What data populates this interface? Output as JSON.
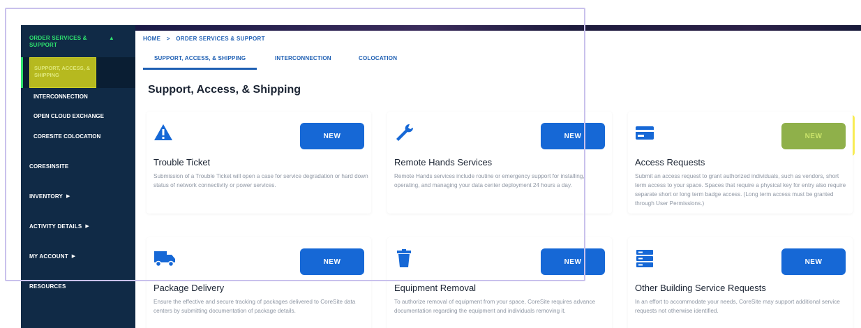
{
  "sidebar": {
    "section_top": "ORDER SERVICES & SUPPORT",
    "section_top_caret": "▲",
    "sub_items": [
      {
        "label": "SUPPORT, ACCESS, & SHIPPING"
      },
      {
        "label": "INTERCONNECTION"
      },
      {
        "label": "OPEN CLOUD EXCHANGE"
      },
      {
        "label": "CORESITE COLOCATION"
      }
    ],
    "sections": [
      {
        "label": "CORESINSITE",
        "caret": ""
      },
      {
        "label": "INVENTORY",
        "caret": "▶"
      },
      {
        "label": "ACTIVITY DETAILS",
        "caret": "▶"
      },
      {
        "label": "MY ACCOUNT",
        "caret": "▶"
      },
      {
        "label": "RESOURCES",
        "caret": ""
      }
    ]
  },
  "breadcrumb": {
    "home": "HOME",
    "separator": ">",
    "current": "ORDER SERVICES & SUPPORT"
  },
  "tabs": [
    {
      "label": "SUPPORT, ACCESS, & SHIPPING",
      "active": true
    },
    {
      "label": "INTERCONNECTION",
      "active": false
    },
    {
      "label": "COLOCATION",
      "active": false
    }
  ],
  "page_title": "Support, Access, & Shipping",
  "cards": [
    {
      "icon": "warning-icon",
      "button": "NEW",
      "title": "Trouble Ticket",
      "description": "Submission of a Trouble Ticket will open a case for service degradation or hard down status of network connectivity or power services."
    },
    {
      "icon": "wrench-icon",
      "button": "NEW",
      "title": "Remote Hands Services",
      "description": "Remote Hands services include routine or emergency support for installing, operating, and managing your data center deployment 24 hours a day."
    },
    {
      "icon": "id-card-icon",
      "button": "NEW",
      "title": "Access Requests",
      "description": "Submit an access request to grant authorized individuals, such as vendors, short term access to your space. Spaces that require a physical key for entry also require separate short or long term badge access. (Long term access must be granted through User Permissions.)"
    },
    {
      "icon": "truck-icon",
      "button": "NEW",
      "title": "Package Delivery",
      "description": "Ensure the effective and secure tracking of packages delivered to CoreSite data centers by submitting documentation of package details."
    },
    {
      "icon": "trash-icon",
      "button": "NEW",
      "title": "Equipment Removal",
      "description": "To authorize removal of equipment from your space, CoreSite requires advance documentation regarding the equipment and individuals removing it."
    },
    {
      "icon": "server-icon",
      "button": "NEW",
      "title": "Other Building Service Requests",
      "description": "In an effort to accommodate your needs, CoreSite may support additional service requests not otherwise identified."
    }
  ],
  "colors": {
    "sidebar_bg": "#102a46",
    "accent_green": "#2ee26f",
    "primary_blue": "#1668d6",
    "highlight_yellow": "#fbf056"
  }
}
